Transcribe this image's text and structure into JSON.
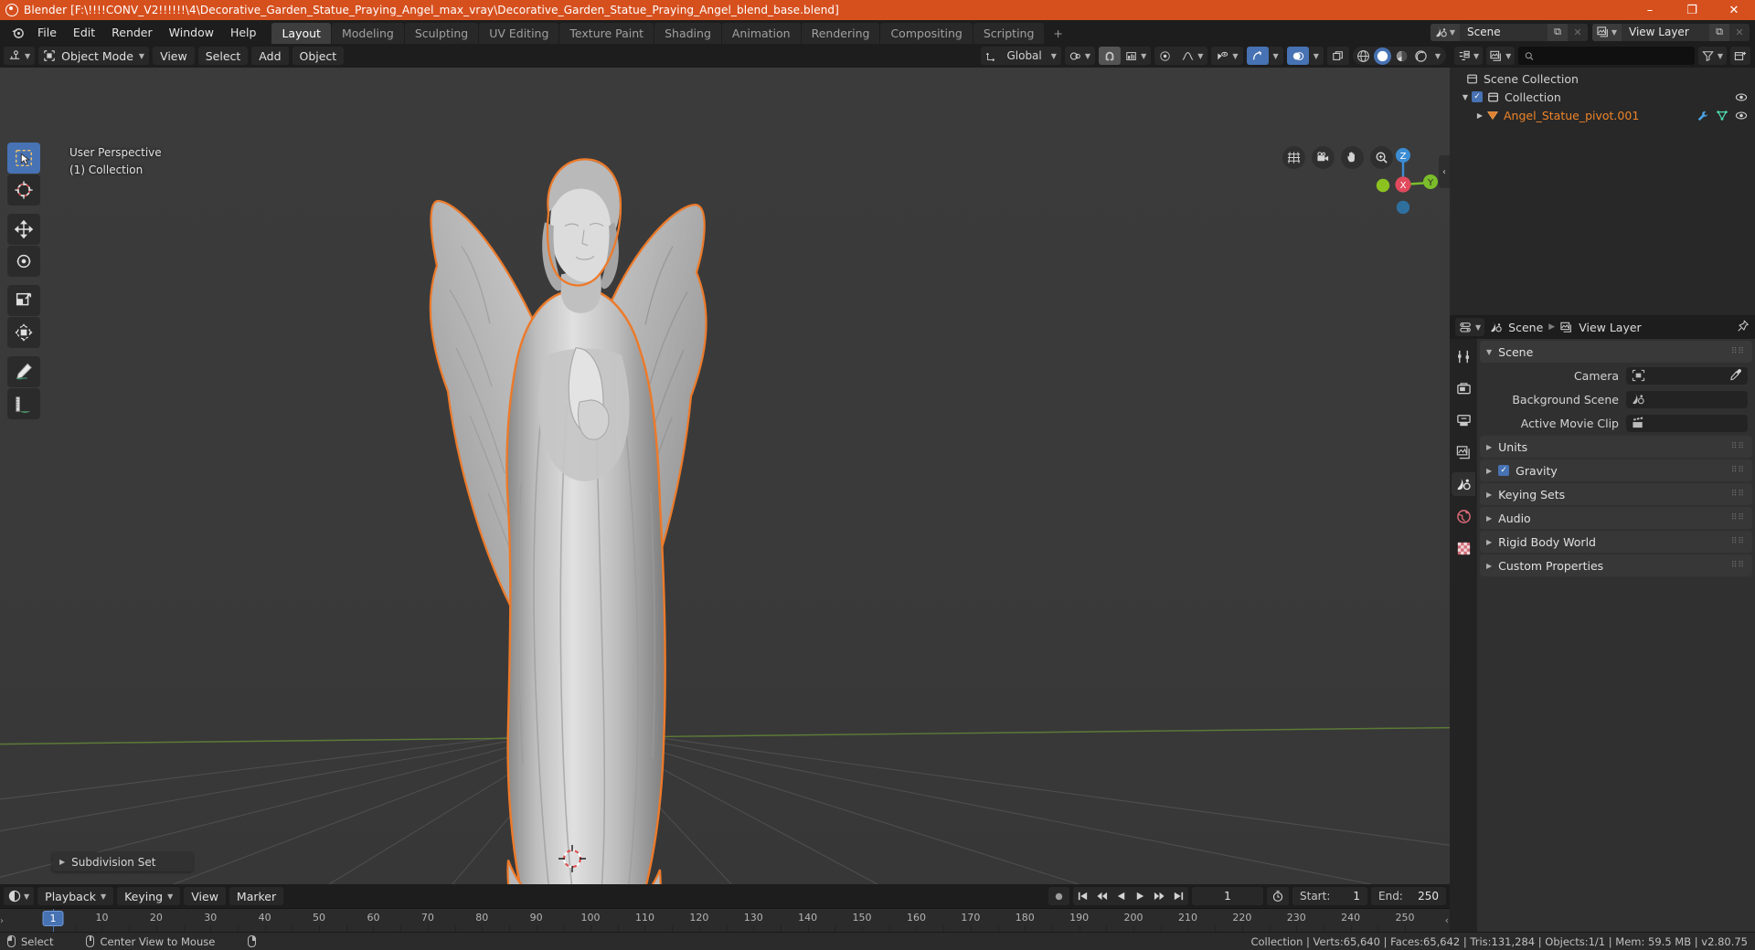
{
  "titlebar": {
    "title": "Blender [F:\\!!!!CONV_V2!!!!!!\\4\\Decorative_Garden_Statue_Praying_Angel_max_vray\\Decorative_Garden_Statue_Praying_Angel_blend_base.blend]",
    "minimize": "–",
    "maximize": "❐",
    "close": "✕",
    "accent_color": "#d6501e"
  },
  "topbar": {
    "menus": [
      "File",
      "Edit",
      "Render",
      "Window",
      "Help"
    ],
    "workspaces": [
      {
        "label": "Layout",
        "active": true
      },
      {
        "label": "Modeling",
        "active": false
      },
      {
        "label": "Sculpting",
        "active": false
      },
      {
        "label": "UV Editing",
        "active": false
      },
      {
        "label": "Texture Paint",
        "active": false
      },
      {
        "label": "Shading",
        "active": false
      },
      {
        "label": "Animation",
        "active": false
      },
      {
        "label": "Rendering",
        "active": false
      },
      {
        "label": "Compositing",
        "active": false
      },
      {
        "label": "Scripting",
        "active": false
      }
    ],
    "add_workspace": "+",
    "scene_name": "Scene",
    "view_layer_name": "View Layer",
    "new_button": "⧉",
    "unlink_button": "✕"
  },
  "viewport_header": {
    "editor_type_icon": "editor-type-icon",
    "mode": "Object Mode",
    "menus": [
      "View",
      "Select",
      "Add",
      "Object"
    ],
    "transform_orientation": "Global",
    "snap_icon": "magnet-icon",
    "proportional_icon": "proportional-edit-icon",
    "show_gizmo_icon": "gizmo-icon",
    "show_overlays_icon": "overlays-icon",
    "xray_icon": "xray-icon",
    "shading_modes": [
      "wireframe",
      "solid",
      "material-preview",
      "rendered"
    ],
    "active_shading": "solid"
  },
  "viewport": {
    "perspective_label": "User Perspective",
    "collection_label": "(1) Collection",
    "redo_panel_label": "Subdivision Set",
    "gizmo_axes": [
      {
        "label": "Z",
        "color": "#3c8dd4"
      },
      {
        "label": "X",
        "color": "#e04a5c"
      },
      {
        "label": "Y",
        "color": "#7bbd2a"
      }
    ],
    "nav_buttons": [
      "grid-toggle-icon",
      "camera-view-icon",
      "pan-view-icon",
      "zoom-view-icon"
    ],
    "tools": [
      {
        "name": "select-box-tool",
        "active": true
      },
      {
        "name": "cursor-tool",
        "active": false
      },
      {
        "name": "move-tool",
        "active": false
      },
      {
        "name": "rotate-tool",
        "active": false
      },
      {
        "name": "scale-tool",
        "active": false
      },
      {
        "name": "transform-tool",
        "active": false
      },
      {
        "name": "annotate-tool",
        "active": false
      },
      {
        "name": "measure-tool",
        "active": false
      }
    ],
    "object_outline_color": "#ed7a2a"
  },
  "outliner": {
    "display_mode_icon": "outliner-display-icon",
    "filter_icon": "filter-icon",
    "new_collection_icon": "new-collection-icon",
    "search_placeholder": "",
    "rows": [
      {
        "label": "Scene Collection",
        "depth": 0,
        "type": "scene-collection",
        "selected": false,
        "has_disclosure": false,
        "has_checkbox": false,
        "has_eye": false
      },
      {
        "label": "Collection",
        "depth": 1,
        "type": "collection",
        "selected": false,
        "has_disclosure": true,
        "has_checkbox": true,
        "has_eye": true
      },
      {
        "label": "Angel_Statue_pivot.001",
        "depth": 2,
        "type": "mesh-object",
        "selected": true,
        "has_disclosure": true,
        "has_checkbox": false,
        "has_eye": true
      }
    ]
  },
  "properties": {
    "editor_icon": "properties-editor-icon",
    "breadcrumb": [
      "Scene",
      "View Layer"
    ],
    "pin_icon": "pin-icon",
    "tabs": [
      {
        "name": "tool-tab",
        "active": false
      },
      {
        "name": "render-tab",
        "active": false
      },
      {
        "name": "output-tab",
        "active": false
      },
      {
        "name": "view-layer-tab",
        "active": false
      },
      {
        "name": "scene-tab",
        "active": true
      },
      {
        "name": "world-tab",
        "active": false
      },
      {
        "name": "texture-tab",
        "active": false
      }
    ],
    "scene_panel": {
      "title": "Scene",
      "expanded": true,
      "fields": [
        {
          "label": "Camera",
          "value": "",
          "icon": "camera-icon",
          "has_eyedropper": true
        },
        {
          "label": "Background Scene",
          "value": "",
          "icon": "scene-icon",
          "has_eyedropper": false
        },
        {
          "label": "Active Movie Clip",
          "value": "",
          "icon": "clip-icon",
          "has_eyedropper": false
        }
      ]
    },
    "collapsed_panels": [
      {
        "title": "Units",
        "has_checkbox": false
      },
      {
        "title": "Gravity",
        "has_checkbox": true,
        "checked": true
      },
      {
        "title": "Keying Sets",
        "has_checkbox": false
      },
      {
        "title": "Audio",
        "has_checkbox": false
      },
      {
        "title": "Rigid Body World",
        "has_checkbox": false
      },
      {
        "title": "Custom Properties",
        "has_checkbox": false
      }
    ]
  },
  "timeline": {
    "editor_icon": "timeline-editor-icon",
    "menus": [
      "Playback",
      "Keying",
      "View",
      "Marker"
    ],
    "record_icon": "record-icon",
    "transport": [
      "jump-start-icon",
      "prev-keyframe-icon",
      "play-reverse-icon",
      "play-icon",
      "next-keyframe-icon",
      "jump-end-icon"
    ],
    "current_frame": "1",
    "auto_key_icon": "auto-keying-icon",
    "start_label": "Start:",
    "start_value": "1",
    "end_label": "End:",
    "end_value": "250",
    "ticks": [
      10,
      20,
      30,
      40,
      50,
      60,
      70,
      80,
      90,
      100,
      110,
      120,
      130,
      140,
      150,
      160,
      170,
      180,
      190,
      200,
      210,
      220,
      230,
      240,
      250
    ],
    "playhead_frame": "1"
  },
  "statusbar": {
    "hints": [
      {
        "icon": "mouse-left-icon",
        "label": "Select"
      },
      {
        "icon": "mouse-middle-icon",
        "label": "Center View to Mouse"
      },
      {
        "icon": "mouse-right-icon",
        "label": ""
      }
    ],
    "stats": "Collection | Verts:65,640 | Faces:65,642 | Tris:131,284 | Objects:1/1 | Mem: 59.5 MB | v2.80.75"
  }
}
